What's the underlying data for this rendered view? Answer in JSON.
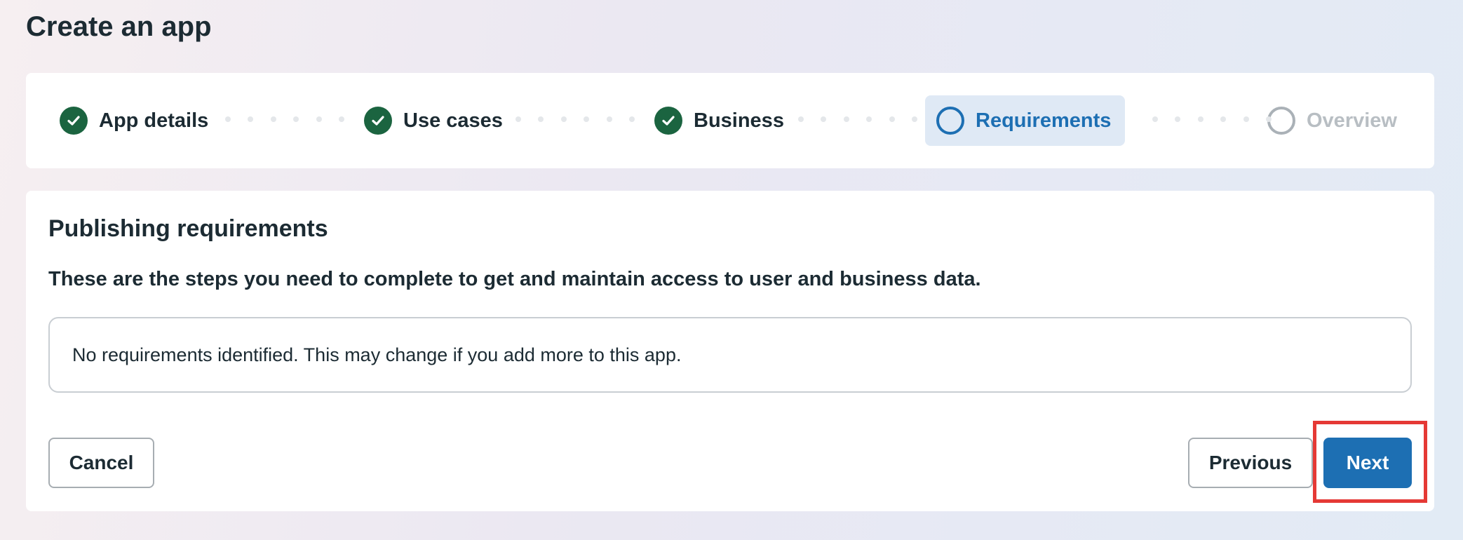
{
  "page": {
    "title": "Create an app"
  },
  "stepper": {
    "steps": [
      {
        "label": "App details",
        "state": "done",
        "icon": "check-circle-icon"
      },
      {
        "label": "Use cases",
        "state": "done",
        "icon": "check-circle-icon"
      },
      {
        "label": "Business",
        "state": "done",
        "icon": "check-circle-icon"
      },
      {
        "label": "Requirements",
        "state": "current",
        "icon": "empty-circle-icon"
      },
      {
        "label": "Overview",
        "state": "future",
        "icon": "empty-circle-icon"
      }
    ]
  },
  "main": {
    "section_title": "Publishing requirements",
    "description": "These are the steps you need to complete to get and maintain access to user and business data.",
    "info_message": "No requirements identified. This may change if you add more to this app."
  },
  "actions": {
    "cancel_label": "Cancel",
    "previous_label": "Previous",
    "next_label": "Next"
  },
  "colors": {
    "accent": "#1d6fb3",
    "done_green": "#1b6440",
    "highlight": "#e53935",
    "current_step_bg": "#dfe9f5"
  }
}
